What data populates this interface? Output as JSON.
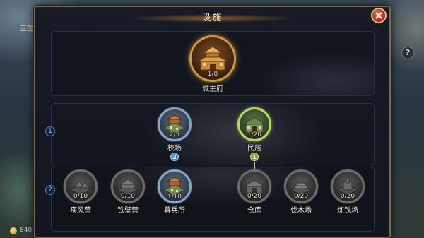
{
  "screen": {
    "background_corner_text": "三国",
    "background_help": "?",
    "background_coin_value": "840"
  },
  "dialog": {
    "title": "设施",
    "close_label": "X"
  },
  "tiers": [
    {
      "number": "1"
    },
    {
      "number": "2"
    }
  ],
  "buildings": {
    "main": {
      "name": "城主府",
      "count": "1/8",
      "state": "built"
    },
    "tier1": [
      {
        "id": "drill-ground",
        "name": "校场",
        "count": "2/5",
        "badge": "2",
        "state": "built"
      },
      {
        "id": "residence",
        "name": "民居",
        "count": "1/20",
        "badge": "1",
        "state": "upgradable"
      }
    ],
    "tier2": [
      {
        "id": "gale-camp",
        "name": "疾风营",
        "count": "0/10",
        "state": "locked"
      },
      {
        "id": "iron-wall-camp",
        "name": "铁壁营",
        "count": "0/10",
        "state": "locked"
      },
      {
        "id": "recruit-office",
        "name": "募兵所",
        "count": "1/10",
        "state": "built"
      },
      {
        "id": "warehouse",
        "name": "仓库",
        "count": "0/20",
        "state": "locked"
      },
      {
        "id": "lumber-yard",
        "name": "伐木场",
        "count": "0/20",
        "state": "locked"
      },
      {
        "id": "smelter",
        "name": "炼铁场",
        "count": "0/20",
        "state": "locked"
      }
    ]
  },
  "colors": {
    "panel_border": "#7a6a48",
    "close_button": "#c8372b",
    "highlight_green": "#b8d86a",
    "built_blue": "#8aa6c2",
    "locked_grey": "#6c6c6c"
  }
}
